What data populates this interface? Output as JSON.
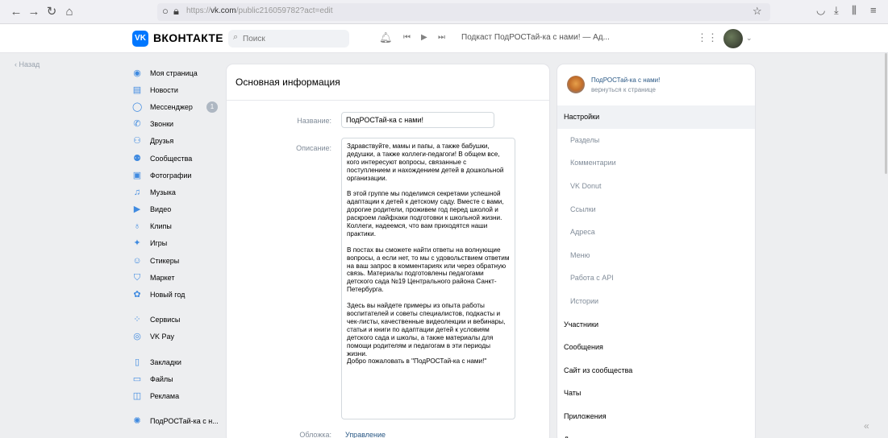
{
  "browser": {
    "url_prefix": "https://",
    "url_domain": "vk.com",
    "url_path": "/public216059782?act=edit"
  },
  "header": {
    "logo_text": "VK",
    "brand": "ВКОНТАКТЕ",
    "search_placeholder": "Поиск",
    "player_text": "Подкаст ПодРОСТай-ка с нами! — Ад..."
  },
  "back_label": "Назад",
  "sidebar": {
    "items": [
      {
        "label": "Моя страница",
        "icon": "user-icon"
      },
      {
        "label": "Новости",
        "icon": "news-icon"
      },
      {
        "label": "Мессенджер",
        "icon": "messenger-icon",
        "badge": "1"
      },
      {
        "label": "Звонки",
        "icon": "phone-icon"
      },
      {
        "label": "Друзья",
        "icon": "friends-icon"
      },
      {
        "label": "Сообщества",
        "icon": "communities-icon"
      },
      {
        "label": "Фотографии",
        "icon": "photo-icon"
      },
      {
        "label": "Музыка",
        "icon": "music-icon"
      },
      {
        "label": "Видео",
        "icon": "video-icon"
      },
      {
        "label": "Клипы",
        "icon": "clips-icon"
      },
      {
        "label": "Игры",
        "icon": "games-icon"
      },
      {
        "label": "Стикеры",
        "icon": "stickers-icon"
      },
      {
        "label": "Маркет",
        "icon": "market-icon"
      },
      {
        "label": "Новый год",
        "icon": "gift-icon"
      }
    ],
    "items2": [
      {
        "label": "Сервисы",
        "icon": "services-icon"
      },
      {
        "label": "VK Pay",
        "icon": "vkpay-icon"
      }
    ],
    "items3": [
      {
        "label": "Закладки",
        "icon": "bookmarks-icon"
      },
      {
        "label": "Файлы",
        "icon": "files-icon"
      },
      {
        "label": "Реклама",
        "icon": "ads-icon"
      }
    ],
    "items4": [
      {
        "label": "ПодРОСТай-ка с н...",
        "icon": "group-icon"
      }
    ]
  },
  "main": {
    "title": "Основная информация",
    "name_label": "Название:",
    "name_value": "ПодРОСТай-ка с нами!",
    "desc_label": "Описание:",
    "description": [
      "Здравствуйте, мамы и папы, а также бабушки, дедушки, а также коллеги-педагоги! В общем все, кого интересуют вопросы, связанные с поступлением и нахождением детей в дошкольной организации.",
      "В этой группе мы поделимся секретами успешной адаптации к детей к детскому саду. Вместе с вами, дорогие родители, проживем  год перед школой и  раскроем лайфхаки подготовки к школьной жизни. Коллеги, надеемся, что вам приходятся наши практики.",
      "В постах вы сможете найти ответы на волнующие вопросы, а если нет, то мы с удовольствием ответим на ваш запрос в комментариях или через обратную связь. Материалы подготовлены педагогами детского сада №19  Центрального района Санкт-Петербурга.",
      "Здесь вы найдете примеры из опыта работы воспитателей и советы специалистов, подкасты и чек-листы, качественные видеолекции и вебинары, статьи и книги по адаптации детей к условиям детского сада и школы, а также материалы для помощи родителям и педагогам в эти периоды жизни.\nДобро пожаловать в \"ПодРОСТай-ка с нами!\""
    ],
    "cover_label": "Обложка:",
    "cover_link": "Управление"
  },
  "right": {
    "group_name": "ПодРОСТай-ка с нами!",
    "group_back": "вернуться к странице",
    "menu": [
      {
        "label": "Настройки",
        "sub": false,
        "active": true
      },
      {
        "label": "Разделы",
        "sub": true
      },
      {
        "label": "Комментарии",
        "sub": true
      },
      {
        "label": "VK Donut",
        "sub": true
      },
      {
        "label": "Ссылки",
        "sub": true
      },
      {
        "label": "Адреса",
        "sub": true
      },
      {
        "label": "Меню",
        "sub": true
      },
      {
        "label": "Работа с API",
        "sub": true
      },
      {
        "label": "Истории",
        "sub": true
      },
      {
        "label": "Участники",
        "sub": false
      },
      {
        "label": "Сообщения",
        "sub": false
      },
      {
        "label": "Сайт из сообщества",
        "sub": false
      },
      {
        "label": "Чаты",
        "sub": false
      },
      {
        "label": "Приложения",
        "sub": false
      },
      {
        "label": "Денежные переводы",
        "sub": false
      }
    ]
  },
  "colors": {
    "accent": "#0077ff",
    "link": "#2a5885",
    "muted": "#818c99",
    "icon": "#3f8ae0"
  }
}
